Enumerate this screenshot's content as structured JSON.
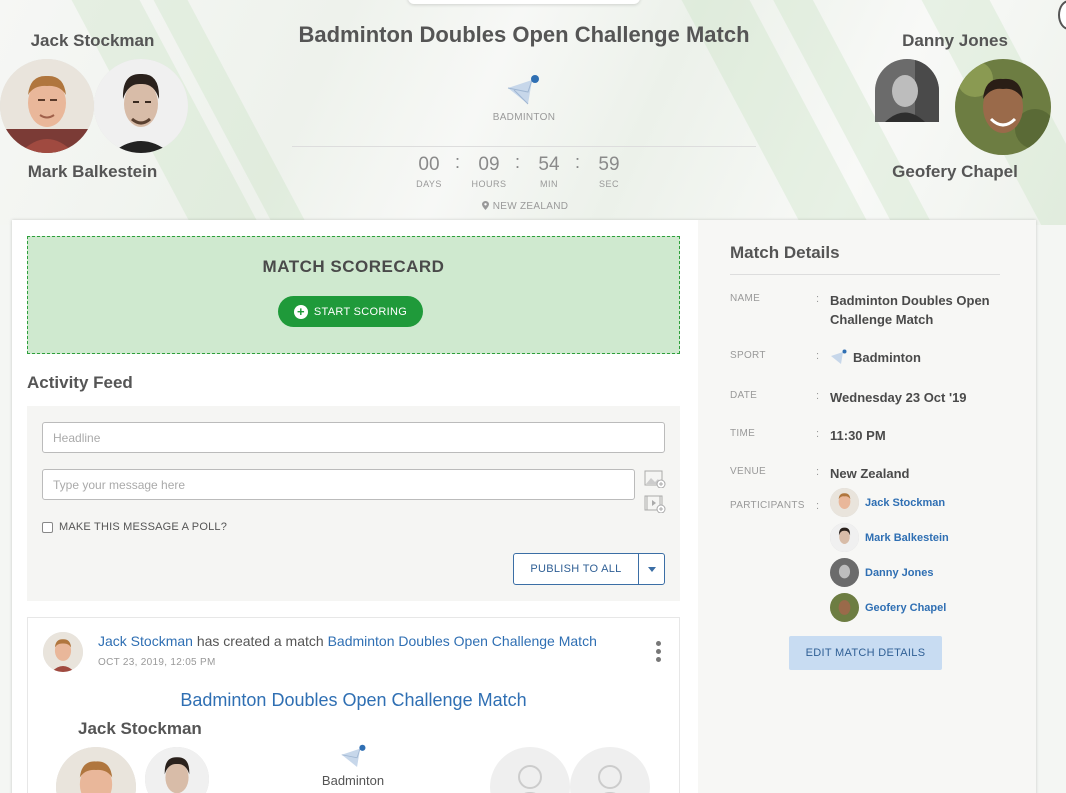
{
  "match": {
    "title": "Badminton Doubles Open Challenge Match",
    "sport": "BADMINTON",
    "location": "NEW ZEALAND"
  },
  "team_left": {
    "top_name": "Jack Stockman",
    "bottom_name": "Mark Balkestein"
  },
  "team_right": {
    "top_name": "Danny Jones",
    "bottom_name": "Geofery Chapel"
  },
  "countdown": {
    "days": "00",
    "days_label": "DAYS",
    "hours": "09",
    "hours_label": "HOURS",
    "min": "54",
    "min_label": "MIN",
    "sec": "59",
    "sec_label": "SEC",
    "separator": ":"
  },
  "scorecard": {
    "title": "MATCH SCORECARD",
    "button": "START SCORING"
  },
  "activity_feed": {
    "title": "Activity Feed",
    "headline_placeholder": "Headline",
    "message_placeholder": "Type your message here",
    "poll_label": "MAKE THIS MESSAGE A POLL?",
    "publish_button": "PUBLISH TO ALL"
  },
  "post": {
    "author": "Jack Stockman",
    "action": "has created a match",
    "match_link": "Badminton Doubles Open Challenge Match",
    "date": "OCT 23, 2019, 12:05 PM",
    "card_title": "Badminton Doubles Open Challenge Match",
    "card_team_name": "Jack Stockman",
    "card_sport": "Badminton"
  },
  "details": {
    "title": "Match Details",
    "colon": ":",
    "name_label": "NAME",
    "name_value_1": "Badminton Doubles Open",
    "name_value_2": "Challenge Match",
    "sport_label": "SPORT",
    "sport_value": "Badminton",
    "date_label": "DATE",
    "date_value": "Wednesday 23 Oct '19",
    "time_label": "TIME",
    "time_value": "11:30 PM",
    "venue_label": "VENUE",
    "venue_value": "New Zealand",
    "participants_label": "PARTICIPANTS",
    "participants": [
      "Jack Stockman",
      "Mark Balkestein",
      "Danny Jones",
      "Geofery Chapel"
    ],
    "edit_button": "EDIT MATCH DETAILS"
  },
  "colors": {
    "accent_green": "#1f9a3a",
    "scorecard_bg": "#cfe9cf",
    "link_blue": "#2f6fb3"
  },
  "icons": [
    "badminton-shuttle-icon",
    "location-pin-icon",
    "plus-circle-icon",
    "image-upload-icon",
    "video-upload-icon",
    "caret-down-icon",
    "kebab-menu-icon",
    "user-placeholder-icon"
  ]
}
